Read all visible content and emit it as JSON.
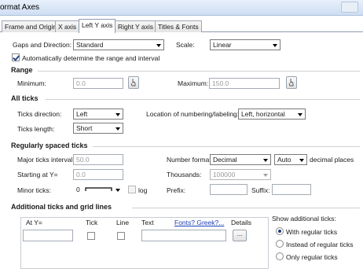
{
  "window": {
    "title": "ormat Axes"
  },
  "tabs": [
    {
      "label": "Frame and Origin",
      "active": false
    },
    {
      "label": "X axis",
      "active": false
    },
    {
      "label": "Left Y axis",
      "active": true
    },
    {
      "label": "Right Y axis",
      "active": false
    },
    {
      "label": "Titles & Fonts",
      "active": false
    }
  ],
  "gaps": {
    "label": "Gaps and Direction:",
    "value": "Standard",
    "scale_label": "Scale:",
    "scale_value": "Linear",
    "auto_label": "Automatically determine the range and interval",
    "auto_checked": true
  },
  "range": {
    "title": "Range",
    "min_label": "Minimum:",
    "min_value": "0.0",
    "max_label": "Maximum:",
    "max_value": "150.0"
  },
  "all_ticks": {
    "title": "All ticks",
    "direction_label": "Ticks direction:",
    "direction_value": "Left",
    "location_label": "Location of numbering/labeling:",
    "location_value": "Left, horizontal",
    "length_label": "Ticks length:",
    "length_value": "Short"
  },
  "regular": {
    "title": "Regularly spaced ticks",
    "major_label": "Major ticks interval:",
    "major_value": "50.0",
    "number_format_label": "Number format:",
    "number_format_value": "Decimal",
    "decimal_places_value": "Auto",
    "decimal_places_label": "decimal places",
    "starting_label": "Starting at Y=",
    "starting_value": "0.0",
    "thousands_label": "Thousands:",
    "thousands_value": "100000",
    "minor_label": "Minor ticks:",
    "minor_value": "0",
    "log_label": "log",
    "prefix_label": "Prefix:",
    "prefix_value": "",
    "suffix_label": "Suffix:",
    "suffix_value": ""
  },
  "additional": {
    "title": "Additional ticks and grid lines",
    "col_at": "At Y=",
    "col_tick": "Tick",
    "col_line": "Line",
    "col_text": "Text",
    "fonts_link": "Fonts? Greek?...",
    "col_details": "Details",
    "details_button": "...",
    "show_label": "Show additional ticks:",
    "options": [
      {
        "label": "With regular ticks",
        "checked": true
      },
      {
        "label": "Instead of regular ticks",
        "checked": false
      },
      {
        "label": "Only regular ticks",
        "checked": false
      }
    ]
  }
}
